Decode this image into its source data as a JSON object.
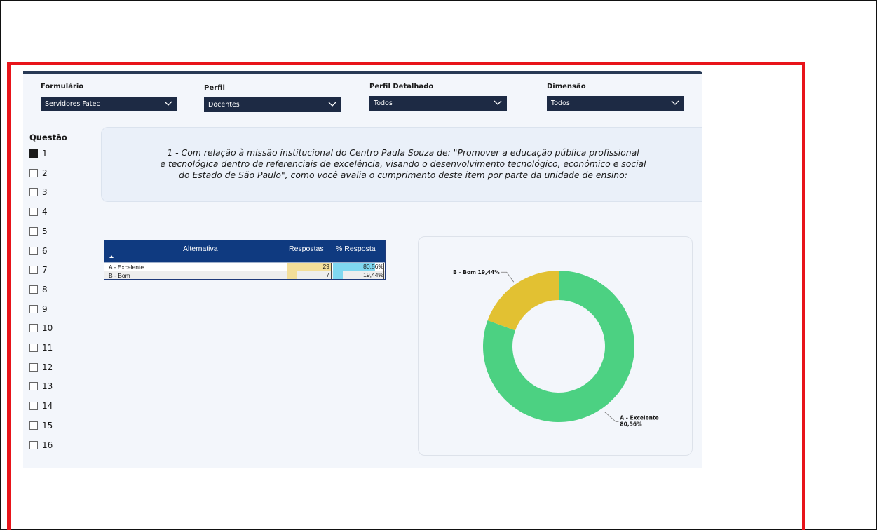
{
  "filters": [
    {
      "label": "Formulário",
      "value": "Servidores Fatec"
    },
    {
      "label": "Perfil",
      "value": "Docentes"
    },
    {
      "label": "Perfil Detalhado",
      "value": "Todos"
    },
    {
      "label": "Dimensão",
      "value": "Todos"
    }
  ],
  "questao": {
    "title": "Questão",
    "items": [
      {
        "num": "1",
        "checked": true
      },
      {
        "num": "2",
        "checked": false
      },
      {
        "num": "3",
        "checked": false
      },
      {
        "num": "4",
        "checked": false
      },
      {
        "num": "5",
        "checked": false
      },
      {
        "num": "6",
        "checked": false
      },
      {
        "num": "7",
        "checked": false
      },
      {
        "num": "8",
        "checked": false
      },
      {
        "num": "9",
        "checked": false
      },
      {
        "num": "10",
        "checked": false
      },
      {
        "num": "11",
        "checked": false
      },
      {
        "num": "12",
        "checked": false
      },
      {
        "num": "13",
        "checked": false
      },
      {
        "num": "14",
        "checked": false
      },
      {
        "num": "15",
        "checked": false
      },
      {
        "num": "16",
        "checked": false
      }
    ]
  },
  "question": {
    "line1": "1 - Com relação à missão institucional do Centro Paula Souza de: \"Promover a educação pública profissional",
    "line2": "e tecnológica dentro de referenciais de excelência, visando o desenvolvimento tecnológico, econômico e social",
    "line3": "do Estado de São Paulo\", como você avalia o cumprimento deste item por parte da unidade de ensino:"
  },
  "table": {
    "headers": {
      "alternativa": "Alternativa",
      "respostas": "Respostas",
      "pct": "% Resposta"
    },
    "rows": [
      {
        "alternativa": "A - Excelente",
        "respostas": "29",
        "pct": "80,56%",
        "respostas_fraction": 1.0,
        "pct_fraction": 0.8056
      },
      {
        "alternativa": "B - Bom",
        "respostas": "7",
        "pct": "19,44%",
        "respostas_fraction": 0.24,
        "pct_fraction": 0.1944
      }
    ]
  },
  "chart_data": {
    "type": "pie",
    "title": "",
    "slices": [
      {
        "name": "A - Excelente",
        "value": 80.56,
        "label_line1": "A - Excelente",
        "label_line2": "80,56%",
        "color": "#4cd182"
      },
      {
        "name": "B - Bom",
        "value": 19.44,
        "label_line1": "B - Bom 19,44%",
        "label_line2": "",
        "color": "#e2c132"
      }
    ],
    "donut": true
  },
  "colors": {
    "filter_bg": "#1d2a44",
    "table_header": "#0f3a80",
    "respostas_bar": "#f3de99",
    "pct_bar": "#7fd8f0"
  }
}
